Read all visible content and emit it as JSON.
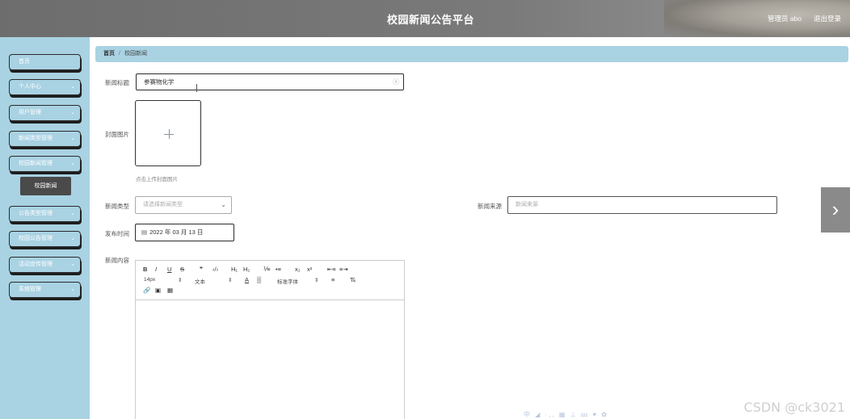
{
  "header": {
    "title": "校园新闻公告平台",
    "user": "管理员 abo",
    "logout": "退出登录"
  },
  "sidebar": {
    "items": [
      {
        "label": "首页",
        "has_arrow": false
      },
      {
        "label": "个人中心",
        "has_arrow": true
      },
      {
        "label": "用户管理",
        "has_arrow": true
      },
      {
        "label": "新闻类型管理",
        "has_arrow": true
      },
      {
        "label": "校园新闻管理",
        "has_arrow": true
      },
      {
        "label": "公告类型管理",
        "has_arrow": true
      },
      {
        "label": "校园公告管理",
        "has_arrow": true
      },
      {
        "label": "活动宣传管理",
        "has_arrow": true
      },
      {
        "label": "系统管理",
        "has_arrow": true
      }
    ],
    "active_submenu": "校园新闻",
    "chevron": "⌄"
  },
  "breadcrumb": {
    "home": "首页",
    "separator": "/",
    "current": "校园新闻"
  },
  "form": {
    "title_label": "新闻标题",
    "title_value": "参赛物化学",
    "clear_icon": "ⓧ",
    "cover_label": "封面图片",
    "upload_tip": "点击上传封面图片",
    "type_label": "新闻类型",
    "type_placeholder": "请选择新闻类型",
    "type_arrow": "⌄",
    "source_label": "新闻来源",
    "source_placeholder": "新闻来源",
    "date_label": "发布时间",
    "date_value": "2022 年 03 月 13 日",
    "date_icon": "▤",
    "content_label": "新闻内容"
  },
  "editor": {
    "row1": [
      "B",
      "I",
      "U",
      "S",
      "❞",
      "‹/›",
      "H₁",
      "H₂",
      "⅟≡",
      "•≡",
      "x₂",
      "x²",
      "⇤≡",
      "≡⇥"
    ],
    "font_size": "14px",
    "text_style": "文本",
    "font_family": "标准字体",
    "select_arrow": "⇕",
    "color_icon": "A",
    "bg_icon": "▒",
    "align_icon": "≡",
    "clear_icon": "T̸ₓ",
    "row3": [
      "🔗",
      "▣",
      "▦"
    ]
  },
  "overlay": {
    "next_arrow": "›",
    "watermark": "CSDN @ck3021",
    "ime": "中 ◢ ·,, ▦ ⊥ ⅏ ♥ ✿"
  }
}
